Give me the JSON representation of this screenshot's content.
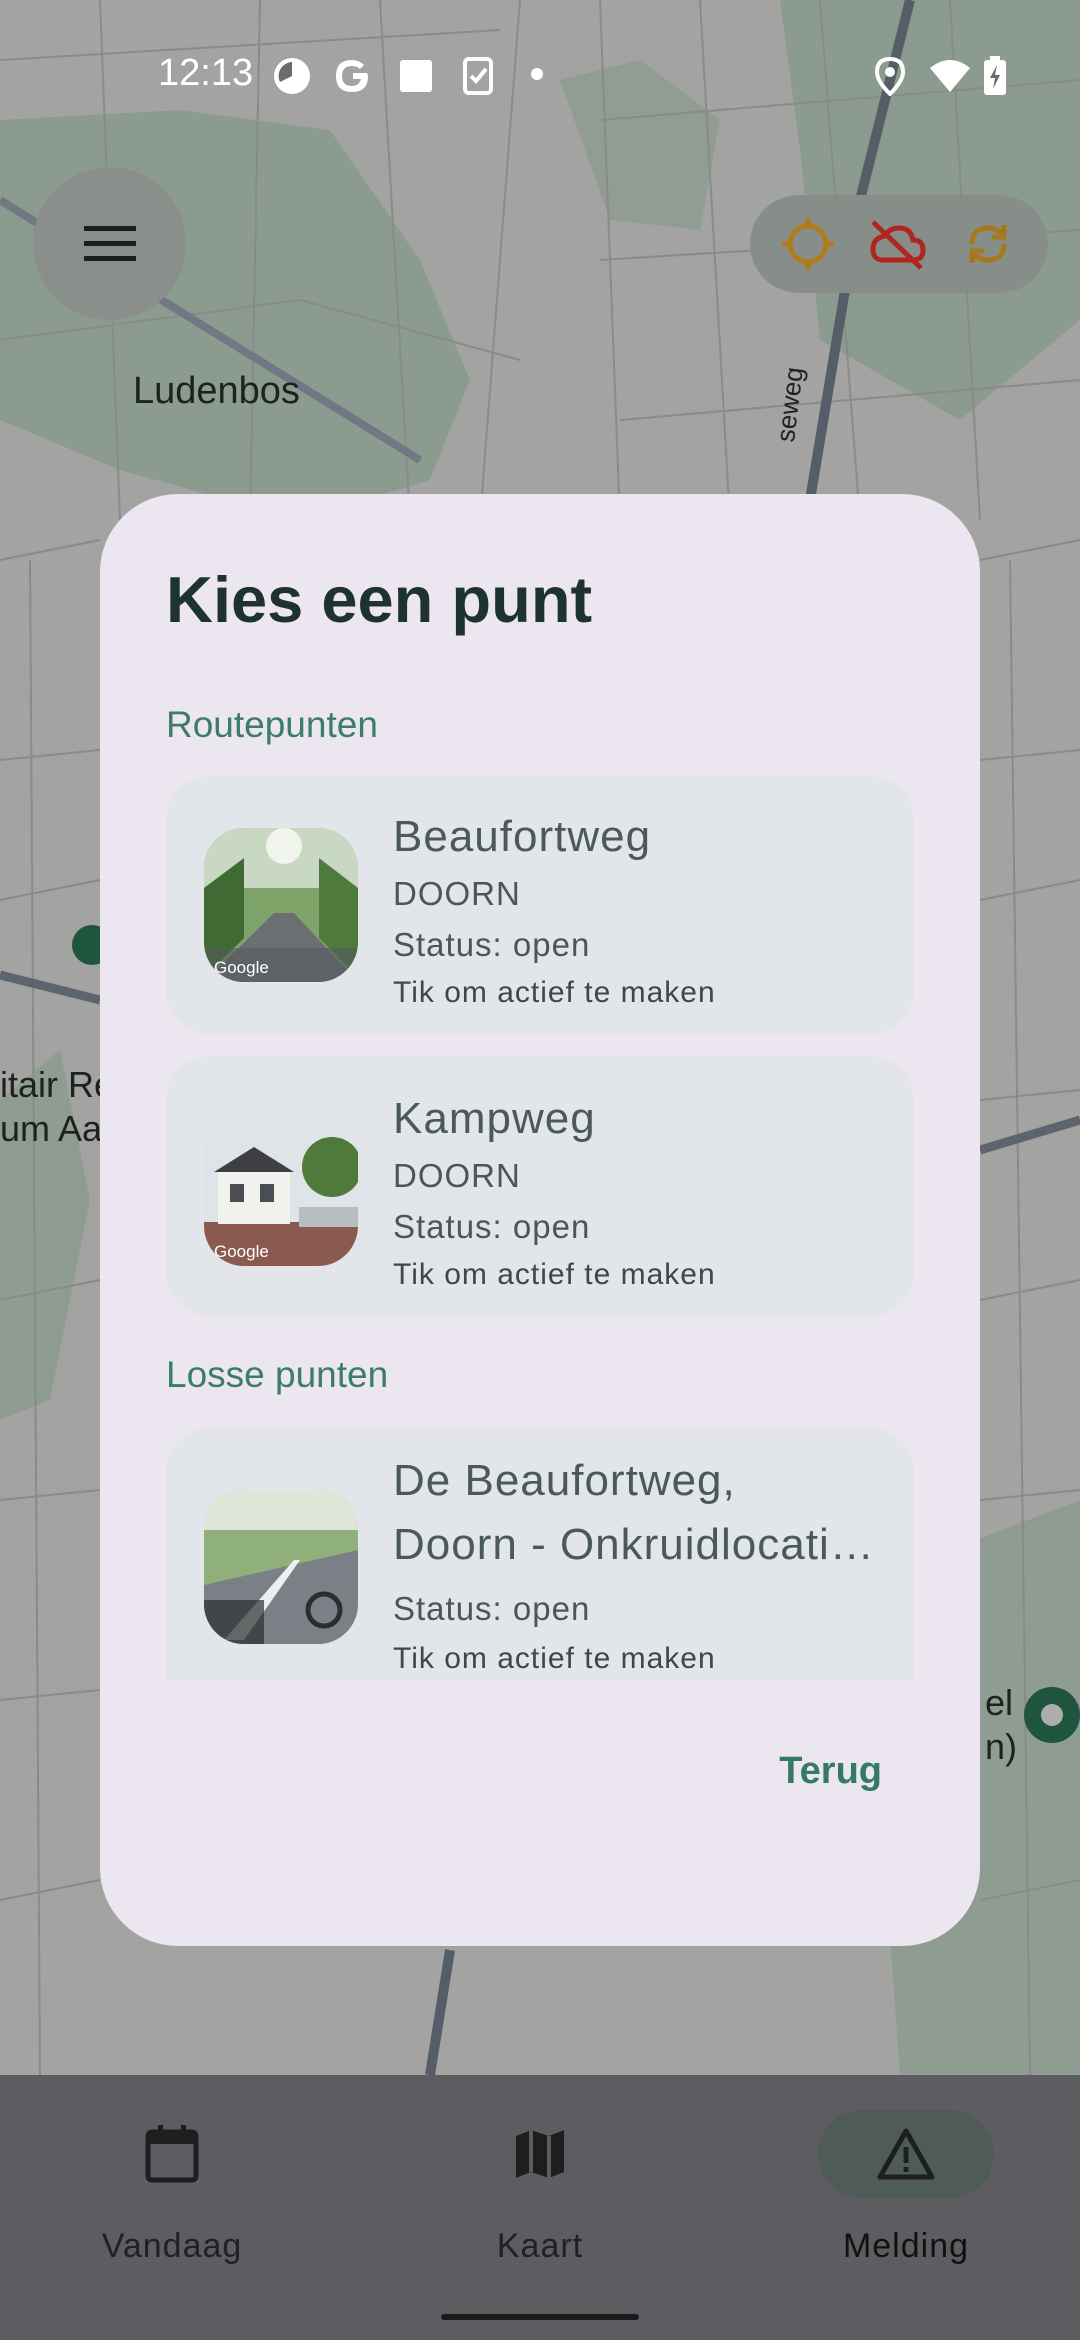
{
  "status_bar": {
    "time": "12:13",
    "icons": [
      "data-saver-icon",
      "google-icon",
      "square-notification-icon",
      "clipboard-check-icon",
      "dot-icon",
      "location-icon",
      "wifi-icon",
      "battery-charging-icon"
    ]
  },
  "map": {
    "place_label": "Ludenbos",
    "road_label": "seweg",
    "edge_label_1": "itair Re",
    "edge_label_2": "um Aa",
    "edge_label_3": "el",
    "edge_label_4": "n)"
  },
  "map_controls": {
    "menu_icon": "hamburger-menu-icon",
    "buttons": [
      "crosshair-icon",
      "cloud-off-icon",
      "sync-icon"
    ],
    "colors": {
      "crosshair": "#b07c1a",
      "cloud_off": "#b0261f",
      "sync": "#a6781c"
    }
  },
  "dialog": {
    "title": "Kies een punt",
    "sections": [
      {
        "label": "Routepunten",
        "items": [
          {
            "title": "Beaufortweg",
            "place": "DOORN",
            "status": "Status: open",
            "hint": "Tik om actief te maken",
            "thumb_watermark": "Google"
          },
          {
            "title": "Kampweg",
            "place": "DOORN",
            "status": "Status: open",
            "hint": "Tik om actief te maken",
            "thumb_watermark": "Google"
          }
        ]
      },
      {
        "label": "Losse punten",
        "items": [
          {
            "title_line1": "De Beaufortweg,",
            "title_line2": "Doorn - Onkruidlocati…",
            "status": "Status: open",
            "hint": "Tik om actief te maken"
          }
        ]
      }
    ],
    "back_label": "Terug"
  },
  "bottom_nav": {
    "items": [
      {
        "label": "Vandaag",
        "icon": "calendar-icon"
      },
      {
        "label": "Kaart",
        "icon": "map-icon"
      },
      {
        "label": "Melding",
        "icon": "warning-icon",
        "selected": true
      }
    ]
  },
  "colors": {
    "accent": "#357a63",
    "dialog_bg": "#ece6f0",
    "card_bg": "#e2e5e9",
    "title_text": "#1e3331"
  }
}
